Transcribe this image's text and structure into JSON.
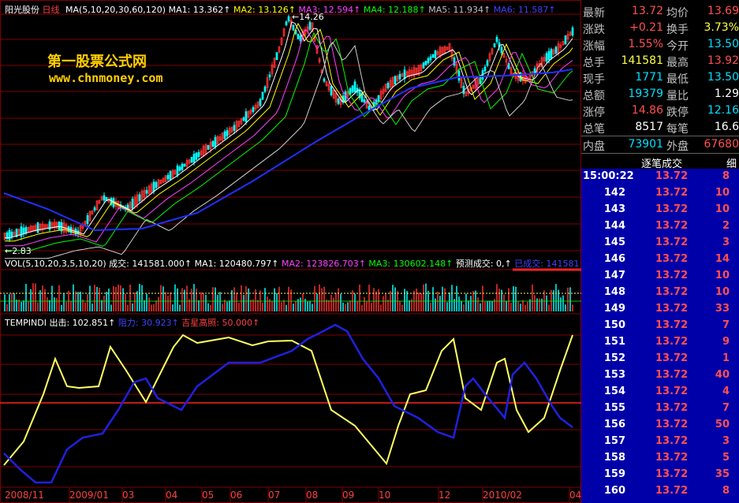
{
  "chart": {
    "title": "阳光股份",
    "period": "日线",
    "ma_header": "MA(5,10,20,30,60,120)",
    "ma_values": [
      {
        "label": "MA1: 13.362",
        "color": "#ffffff"
      },
      {
        "label": "MA2: 13.126",
        "color": "#ffff00"
      },
      {
        "label": "MA3: 12.594",
        "color": "#ff40ff"
      },
      {
        "label": "MA4: 12.188",
        "color": "#00ff00"
      },
      {
        "label": "MA5: 11.934",
        "color": "#c0c0c0"
      },
      {
        "label": "MA6: 11.587",
        "color": "#4040ff"
      }
    ],
    "high_marker": "14.26",
    "low_marker": "2.83",
    "watermark_cn": "第一股票公式网",
    "watermark_url": "www.chnmoney.com",
    "vol_header": "VOL(5,10,20,3,5,10,20)",
    "vol_values": [
      {
        "label": "成交: 141581.000",
        "color": "#ffffff"
      },
      {
        "label": "MA1: 120480.797",
        "color": "#ffffff"
      },
      {
        "label": "MA2: 123826.703",
        "color": "#ff40ff"
      },
      {
        "label": "MA3: 130602.148",
        "color": "#00ff00"
      },
      {
        "label": "预测成交: 0,",
        "color": "#ffffff"
      },
      {
        "label": "已成交: 141581",
        "color": "#4040ff"
      }
    ],
    "ind_name": "TEMPINDI",
    "ind_values": [
      {
        "label": "出击: 102.851",
        "color": "#ffffff"
      },
      {
        "label": "阻力: 30.923",
        "color": "#4040ff"
      },
      {
        "label": "吉星高照: 50.000",
        "color": "#ff4040"
      }
    ],
    "x_labels": [
      "2008/11",
      "2009/01",
      "03",
      "04",
      "05",
      "06",
      "07",
      "08",
      "09",
      "10",
      "12",
      "2010/02",
      "04"
    ]
  },
  "quote": {
    "rows": [
      {
        "l1": "最新",
        "v1": "13.72",
        "c1": "red",
        "l2": "均价",
        "v2": "13.69",
        "c2": "red"
      },
      {
        "l1": "涨跌",
        "v1": "+0.21",
        "c1": "red",
        "l2": "换手",
        "v2": "3.73%",
        "c2": "yellow"
      },
      {
        "l1": "涨幅",
        "v1": "1.55%",
        "c1": "red",
        "l2": "今开",
        "v2": "13.50",
        "c2": "cyan"
      },
      {
        "l1": "总手",
        "v1": "141581",
        "c1": "yellow",
        "l2": "最高",
        "v2": "13.92",
        "c2": "red"
      },
      {
        "l1": "现手",
        "v1": "1771",
        "c1": "cyan",
        "l2": "最低",
        "v2": "13.50",
        "c2": "cyan"
      },
      {
        "l1": "总额",
        "v1": "19379",
        "c1": "cyan",
        "l2": "量比",
        "v2": "1.29",
        "c2": "white"
      },
      {
        "l1": "涨停",
        "v1": "14.86",
        "c1": "red",
        "l2": "跌停",
        "v2": "12.16",
        "c2": "cyan"
      },
      {
        "l1": "总笔",
        "v1": "8517",
        "c1": "white",
        "l2": "每笔",
        "v2": "16.6",
        "c2": "white"
      },
      {
        "l1": "内盘",
        "v1": "73901",
        "c1": "cyan",
        "l2": "外盘",
        "v2": "67680",
        "c2": "red"
      }
    ]
  },
  "trades": {
    "header": "逐笔成交",
    "detail_button": "细",
    "rows": [
      {
        "time": "15:00:22",
        "price": "13.72",
        "vol": "8"
      },
      {
        "time": "142",
        "price": "13.72",
        "vol": "10"
      },
      {
        "time": "143",
        "price": "13.72",
        "vol": "10"
      },
      {
        "time": "144",
        "price": "13.72",
        "vol": "2"
      },
      {
        "time": "145",
        "price": "13.72",
        "vol": "3"
      },
      {
        "time": "146",
        "price": "13.72",
        "vol": "14"
      },
      {
        "time": "147",
        "price": "13.72",
        "vol": "10"
      },
      {
        "time": "148",
        "price": "13.72",
        "vol": "10"
      },
      {
        "time": "149",
        "price": "13.72",
        "vol": "33"
      },
      {
        "time": "150",
        "price": "13.72",
        "vol": "7"
      },
      {
        "time": "151",
        "price": "13.72",
        "vol": "9"
      },
      {
        "time": "152",
        "price": "13.72",
        "vol": "1"
      },
      {
        "time": "153",
        "price": "13.72",
        "vol": "40"
      },
      {
        "time": "154",
        "price": "13.72",
        "vol": "4"
      },
      {
        "time": "155",
        "price": "13.72",
        "vol": "7"
      },
      {
        "time": "156",
        "price": "13.72",
        "vol": "50"
      },
      {
        "time": "157",
        "price": "13.72",
        "vol": "3"
      },
      {
        "time": "158",
        "price": "13.72",
        "vol": "5"
      },
      {
        "time": "159",
        "price": "13.72",
        "vol": "35"
      },
      {
        "time": "160",
        "price": "13.72",
        "vol": "8"
      }
    ]
  },
  "colors": {
    "up": "#ff3030",
    "down": "#00ffff",
    "grid": "#800000",
    "yellow_line": "#ffff60",
    "blue_line": "#2020e0",
    "ref_line": "#ff2020"
  }
}
